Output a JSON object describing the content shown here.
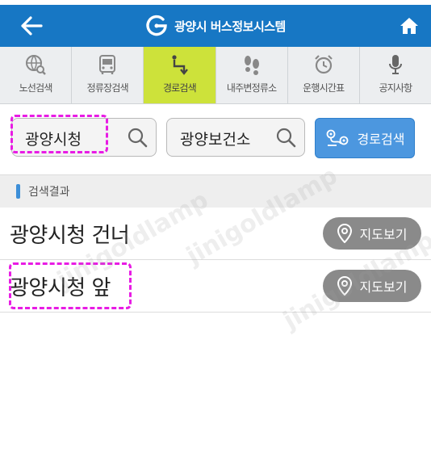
{
  "header": {
    "title": "광양시 버스정보시스템",
    "back_icon": "arrow-left-icon",
    "home_icon": "home-icon",
    "background": "#1777c4"
  },
  "tabs": [
    {
      "label": "노선검색",
      "icon": "globe-search-icon",
      "active": false
    },
    {
      "label": "정류장검색",
      "icon": "bus-icon",
      "active": false
    },
    {
      "label": "경로검색",
      "icon": "route-icon",
      "active": true
    },
    {
      "label": "내주변정류소",
      "icon": "footprints-icon",
      "active": false
    },
    {
      "label": "운행시간표",
      "icon": "alarm-clock-icon",
      "active": false
    },
    {
      "label": "공지사항",
      "icon": "microphone-icon",
      "active": false
    }
  ],
  "search": {
    "origin_value": "광양시청",
    "destination_value": "광양보건소",
    "route_button_label": "경로검색"
  },
  "results": {
    "header_label": "검색결과",
    "items": [
      {
        "name": "광양시청 건너",
        "map_label": "지도보기"
      },
      {
        "name": "광양시청 앞",
        "map_label": "지도보기"
      }
    ]
  },
  "watermark": "jinigoldlamp",
  "colors": {
    "accent": "#1777c4",
    "active_tab": "#cde23a",
    "route_button": "#4c97df",
    "map_button": "#8a8a8a",
    "highlight": "#e81ce4"
  }
}
